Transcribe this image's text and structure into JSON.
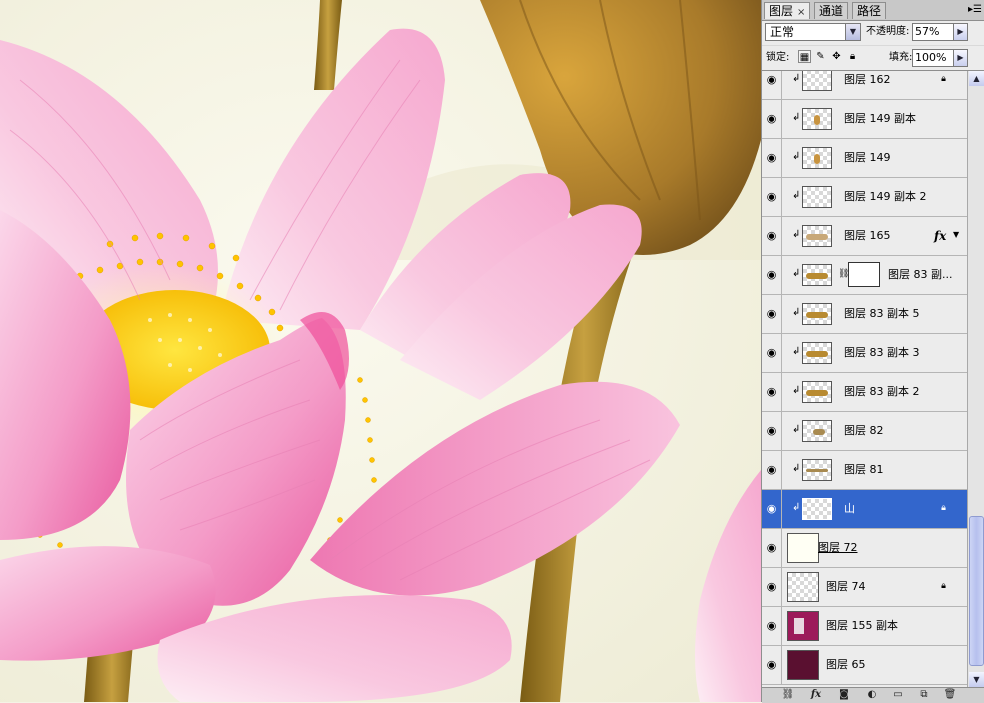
{
  "panel": {
    "tabs": [
      {
        "label": "图层",
        "close": "×"
      },
      {
        "label": "通道"
      },
      {
        "label": "路径"
      }
    ],
    "menu_icon": "panel-menu-icon",
    "blend_mode": "正常",
    "opacity_label": "不透明度:",
    "opacity_value": "57%",
    "lock_label": "锁定:",
    "fill_label": "填充:",
    "fill_value": "100%"
  },
  "layers": [
    {
      "name": "图层 162",
      "clipped": true,
      "locked": true
    },
    {
      "name": "图层 149 副本",
      "clipped": true
    },
    {
      "name": "图层 149",
      "clipped": true
    },
    {
      "name": "图层 149 副本 2",
      "clipped": true
    },
    {
      "name": "图层 165",
      "clipped": true,
      "fx": "fx"
    },
    {
      "name": "图层 83 副...",
      "clipped": true,
      "mask": true
    },
    {
      "name": "图层 83 副本 5",
      "clipped": true
    },
    {
      "name": "图层 83 副本 3",
      "clipped": true
    },
    {
      "name": "图层 83 副本 2",
      "clipped": true
    },
    {
      "name": "图层 82",
      "clipped": true
    },
    {
      "name": "图层 81",
      "clipped": true
    },
    {
      "name": "山",
      "clipped": true,
      "locked": true,
      "selected": true
    },
    {
      "name": "图层 72"
    },
    {
      "name": "图层 74",
      "locked": true
    },
    {
      "name": "图层 155 副本"
    },
    {
      "name": "图层 65"
    }
  ],
  "footer_icons": [
    "link-icon",
    "fx-icon",
    "mask-icon",
    "adjustment-icon",
    "group-folder-icon",
    "new-layer-icon",
    "trash-icon"
  ],
  "colors": {
    "selected_row": "#3366cc",
    "petal_pink": "#f08cbc",
    "stem": "#9a7a22",
    "stamen": "#ffd400",
    "background": "#f5f3e6"
  }
}
